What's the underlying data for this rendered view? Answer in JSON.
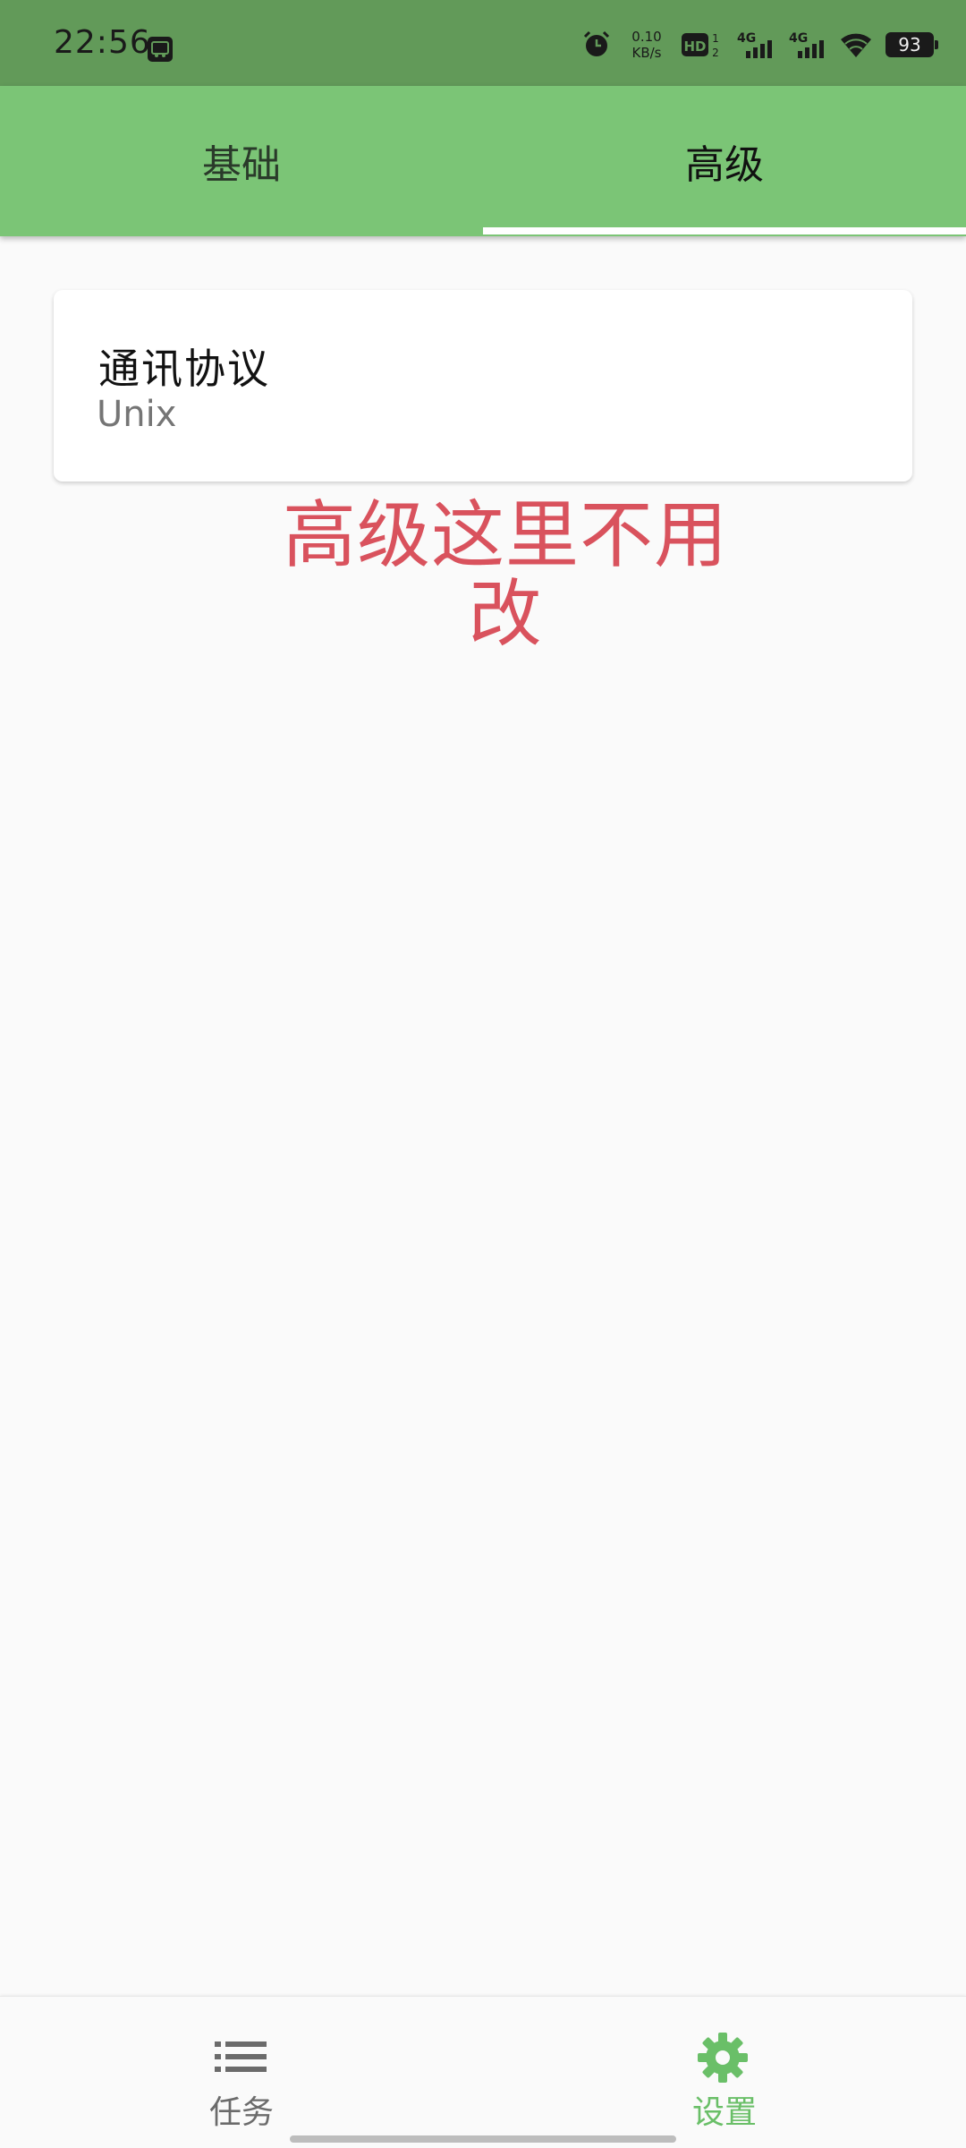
{
  "status_bar": {
    "time": "22:56",
    "net_speed_value": "0.10",
    "net_speed_unit": "KB/s",
    "hd_label": "HD",
    "hd_sub_top": "1",
    "hd_sub_bottom": "2",
    "signal1_label": "4G",
    "signal2_label": "4G",
    "battery": "93"
  },
  "tabs": [
    {
      "label": "基础",
      "selected": false
    },
    {
      "label": "高级",
      "selected": true
    }
  ],
  "card": {
    "title": "通讯协议",
    "subtitle": "Unix"
  },
  "annotation": {
    "line1": "高级这里不用",
    "line2": "改"
  },
  "bottom_nav": [
    {
      "label": "任务",
      "icon": "list-icon",
      "selected": false
    },
    {
      "label": "设置",
      "icon": "gear-icon",
      "selected": true
    }
  ],
  "colors": {
    "status_bar": "#629a59",
    "tab_bar": "#7bc576",
    "accent": "#6abf68",
    "annotation": "#d9525d"
  }
}
